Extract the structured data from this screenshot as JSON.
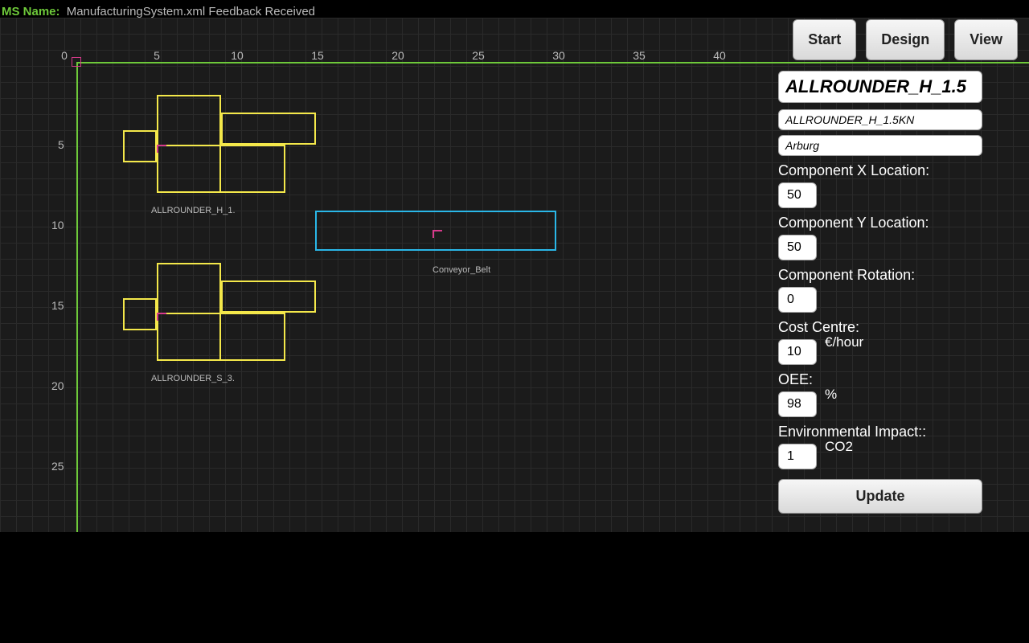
{
  "header": {
    "label": "MS Name:",
    "value": "ManufacturingSystem.xml Feedback Received"
  },
  "ruler_x": [
    "0",
    "5",
    "10",
    "15",
    "20",
    "25",
    "30",
    "35",
    "40"
  ],
  "ruler_y": [
    "5",
    "10",
    "15",
    "20",
    "25"
  ],
  "shapes": {
    "comp1_label": "ALLROUNDER_H_1.",
    "comp2_label": "ALLROUNDER_S_3.",
    "conveyor_label": "Conveyor_Belt"
  },
  "toolbar": {
    "start": "Start",
    "design": "Design",
    "view": "View"
  },
  "panel": {
    "big_name": "ALLROUNDER_H_1.5",
    "name2": "ALLROUNDER_H_1.5KN",
    "name3": "Arburg",
    "x_label": "Component X Location:",
    "x_value": "50",
    "y_label": "Component Y Location:",
    "y_value": "50",
    "rot_label": "Component Rotation:",
    "rot_value": "0",
    "cost_label": "Cost Centre:",
    "cost_value": "10",
    "cost_unit": "€/hour",
    "oee_label": "OEE:",
    "oee_value": "98",
    "oee_unit": "%",
    "env_label": "Environmental Impact::",
    "env_value": "1",
    "env_unit": "CO2",
    "update": "Update"
  }
}
